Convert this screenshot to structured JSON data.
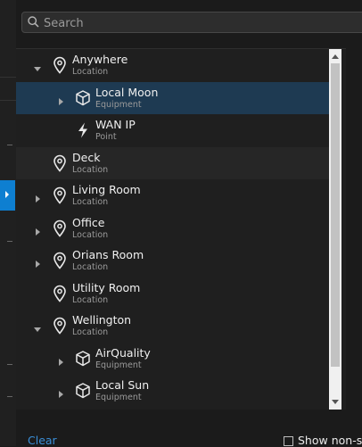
{
  "search": {
    "placeholder": "Search"
  },
  "tree": {
    "items": [
      {
        "title": "Anywhere",
        "subtitle": "Location",
        "icon": "location-pin-icon",
        "expander": "expanded"
      },
      {
        "title": "Local Moon",
        "subtitle": "Equipment",
        "icon": "equipment-cube-icon",
        "expander": "collapsed",
        "selected": true
      },
      {
        "title": "WAN IP",
        "subtitle": "Point",
        "icon": "lightning-bolt-icon",
        "expander": "none"
      },
      {
        "title": "Deck",
        "subtitle": "Location",
        "icon": "location-pin-icon",
        "expander": "none"
      },
      {
        "title": "Living Room",
        "subtitle": "Location",
        "icon": "location-pin-icon",
        "expander": "collapsed"
      },
      {
        "title": "Office",
        "subtitle": "Location",
        "icon": "location-pin-icon",
        "expander": "collapsed"
      },
      {
        "title": "Orians Room",
        "subtitle": "Location",
        "icon": "location-pin-icon",
        "expander": "collapsed"
      },
      {
        "title": "Utility Room",
        "subtitle": "Location",
        "icon": "location-pin-icon",
        "expander": "none"
      },
      {
        "title": "Wellington",
        "subtitle": "Location",
        "icon": "location-pin-icon",
        "expander": "expanded"
      },
      {
        "title": "AirQuality",
        "subtitle": "Equipment",
        "icon": "equipment-cube-icon",
        "expander": "collapsed"
      },
      {
        "title": "Local Sun",
        "subtitle": "Equipment",
        "icon": "equipment-cube-icon",
        "expander": "collapsed"
      }
    ]
  },
  "footer": {
    "clear_label": "Clear",
    "show_label": "Show non-se"
  },
  "colors": {
    "background": "#1b1b1b",
    "selected_row": "#1e3a52",
    "accent": "#0e7fd1",
    "link": "#3a8fd9"
  }
}
